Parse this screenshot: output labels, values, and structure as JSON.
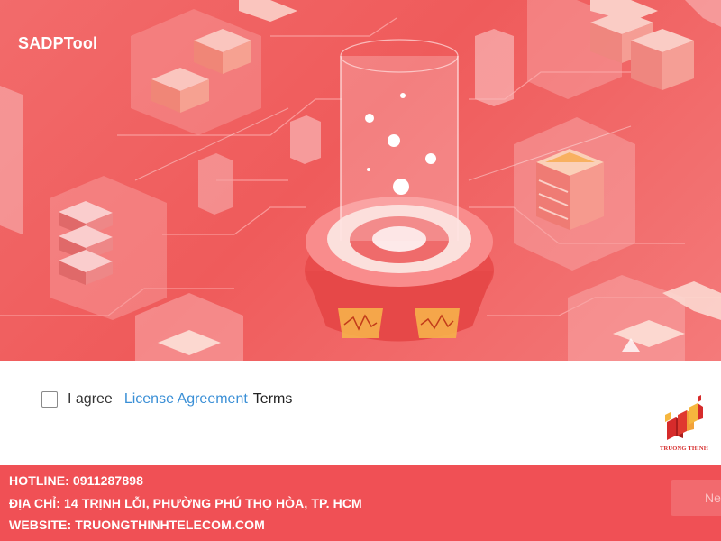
{
  "app": {
    "title": "SADPTool"
  },
  "agreement": {
    "checked": false,
    "agree_label": "I agree",
    "license_link": "License Agreement",
    "terms_label": "Terms"
  },
  "logo": {
    "text": "TRUONG THINH"
  },
  "info_bar": {
    "hotline": "HOTLINE: 0911287898",
    "address": "ĐỊA CHỈ: 14 TRỊNH LỖI, PHƯỜNG PHÚ THỌ HÒA, TP. HCM",
    "website": "WEBSITE: TRUONGTHINHTELECOM.COM",
    "next_button": "Ne"
  },
  "colors": {
    "hero": "#ef5b5b",
    "link": "#3a8fd6",
    "info_bar": "#f05055",
    "logo": "#d62b2b"
  }
}
